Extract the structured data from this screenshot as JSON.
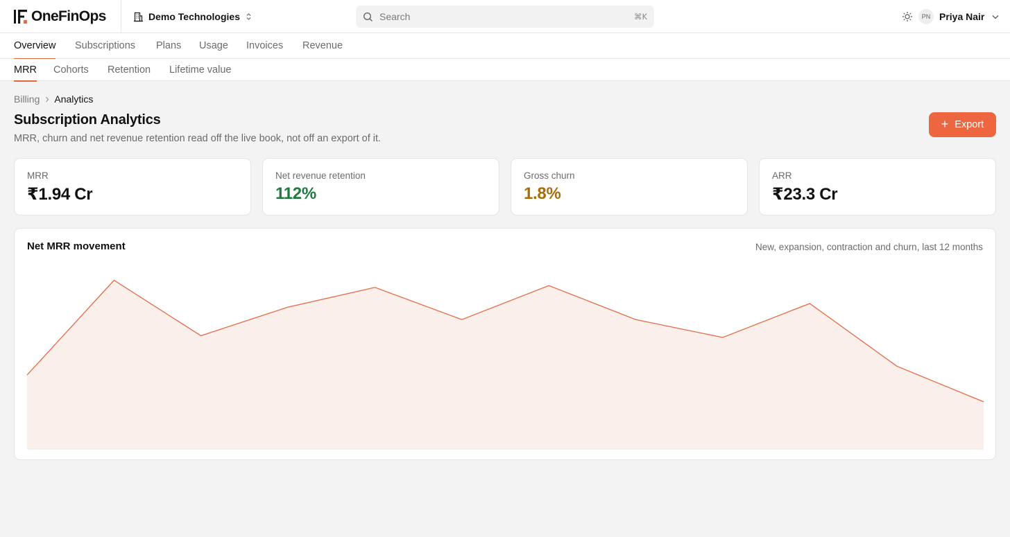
{
  "app": {
    "brand": "OneFinOps",
    "org_name": "Demo Technologies"
  },
  "search": {
    "placeholder": "Search",
    "shortcut": "⌘K"
  },
  "user": {
    "initials": "PN",
    "name": "Priya Nair"
  },
  "nav": {
    "primary_tabs": [
      {
        "label": "Overview",
        "active": true
      },
      {
        "label": "Subscriptions",
        "active": false
      },
      {
        "label": "Plans",
        "active": false
      },
      {
        "label": "Usage",
        "active": false
      },
      {
        "label": "Invoices",
        "active": false
      },
      {
        "label": "Revenue",
        "active": false
      }
    ],
    "secondary_tabs": [
      {
        "label": "MRR",
        "active": true
      },
      {
        "label": "Cohorts",
        "active": false
      },
      {
        "label": "Retention",
        "active": false
      },
      {
        "label": "Lifetime value",
        "active": false
      }
    ]
  },
  "breadcrumb": {
    "parent": "Billing",
    "current": "Analytics"
  },
  "page": {
    "title": "Subscription Analytics",
    "subtitle": "MRR, churn and net revenue retention read off the live book, not off an export of it.",
    "export_label": "Export"
  },
  "kpis": [
    {
      "label": "MRR",
      "value": "₹1.94 Cr",
      "color": "#111111"
    },
    {
      "label": "Net revenue retention",
      "value": "112%",
      "color": "#1e7a3f"
    },
    {
      "label": "Gross churn",
      "value": "1.8%",
      "color": "#a86d0b"
    },
    {
      "label": "ARR",
      "value": "₹23.3 Cr",
      "color": "#111111"
    }
  ],
  "chart_panel": {
    "title": "Net MRR movement",
    "subtitle": "New, expansion, contraction and churn, last 12 months"
  },
  "chart_data": {
    "type": "area",
    "x": [
      1,
      2,
      3,
      4,
      5,
      6,
      7,
      8,
      9,
      10,
      11,
      12
    ],
    "values": [
      41,
      94,
      63,
      79,
      90,
      72,
      91,
      72,
      62,
      81,
      46,
      26
    ],
    "ylim": [
      0,
      100
    ],
    "grid": false,
    "line_color": "#e46a46",
    "fill_color": "#fbefeb",
    "baseline_color": "#e4e4e4"
  },
  "colors": {
    "accent": "#ee6640",
    "active_tab_underline": "#e8643c"
  }
}
